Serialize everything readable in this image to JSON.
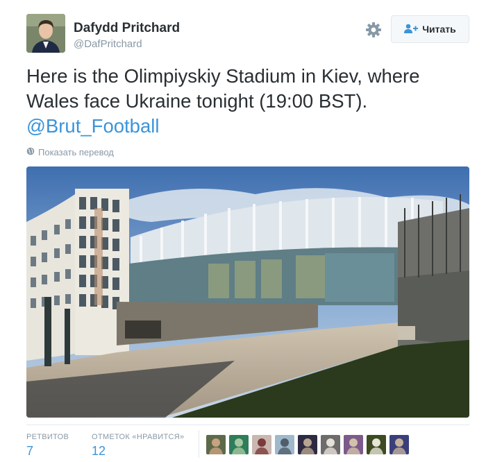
{
  "user": {
    "display_name": "Dafydd Pritchard",
    "handle": "@DafPritchard"
  },
  "actions": {
    "follow_label": "Читать"
  },
  "tweet": {
    "text": "Here is the Olimpiyskiy Stadium in Kiev, where Wales face Ukraine tonight (19:00 BST).",
    "mention": "@Brut_Football",
    "translate_label": "Показать перевод"
  },
  "stats": {
    "retweets_label": "РЕТВИТОВ",
    "retweets_count": "7",
    "likes_label": "ОТМЕТОК «НРАВИТСЯ»",
    "likes_count": "12"
  },
  "icons": {
    "settings": "gear-icon",
    "follow": "add-user-icon",
    "translate": "globe-icon"
  },
  "colors": {
    "link": "#3b94d9",
    "muted": "#8899a6",
    "text": "#292f33",
    "border": "#e1e8ed"
  },
  "likers": [
    {
      "bg": "#5d6a4a",
      "fg": "#c9a27f"
    },
    {
      "bg": "#2f7d5a",
      "fg": "#a5c8a0"
    },
    {
      "bg": "#c9b8b0",
      "fg": "#7a3b3b"
    },
    {
      "bg": "#9fb8cc",
      "fg": "#4f5e6a"
    },
    {
      "bg": "#2f2a44",
      "fg": "#b7a58f"
    },
    {
      "bg": "#6d6b6b",
      "fg": "#e5e0d8"
    },
    {
      "bg": "#7d5a8c",
      "fg": "#d2c2a8"
    },
    {
      "bg": "#3d4a22",
      "fg": "#e6e5d6"
    },
    {
      "bg": "#3a3f7a",
      "fg": "#c6b09b"
    }
  ]
}
